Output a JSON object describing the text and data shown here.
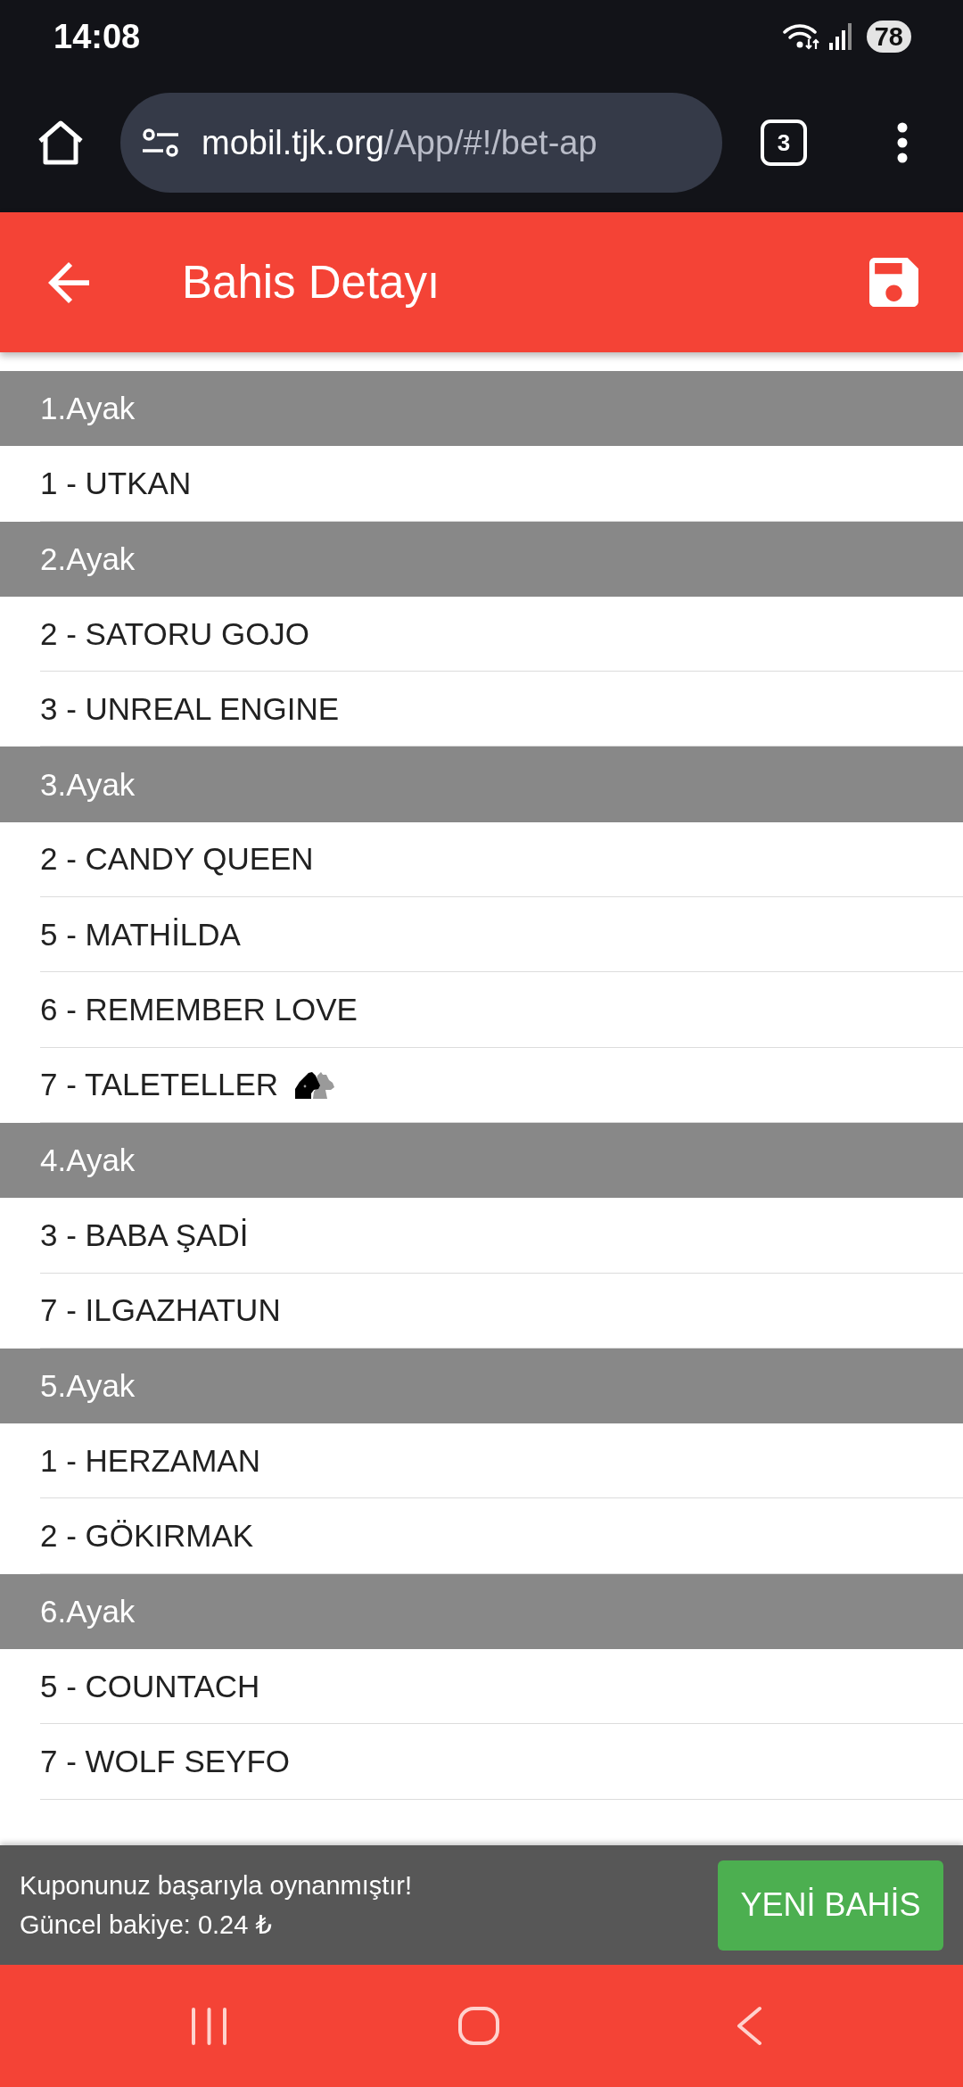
{
  "status_bar": {
    "time": "14:08",
    "battery": "78"
  },
  "browser_toolbar": {
    "url_host": "mobil.tjk.org",
    "url_path": "/App/#!/bet-ap",
    "tab_count": "3"
  },
  "app_bar": {
    "title": "Bahis Detayı"
  },
  "legs": [
    {
      "title": "1.Ayak",
      "runners": [
        {
          "label": "1 - UTKAN",
          "has_icon": false
        }
      ]
    },
    {
      "title": "2.Ayak",
      "runners": [
        {
          "label": "2 - SATORU GOJO",
          "has_icon": false
        },
        {
          "label": "3 - UNREAL ENGINE",
          "has_icon": false
        }
      ]
    },
    {
      "title": "3.Ayak",
      "runners": [
        {
          "label": "2 - CANDY QUEEN",
          "has_icon": false
        },
        {
          "label": "5 - MATHİLDA",
          "has_icon": false
        },
        {
          "label": "6 - REMEMBER LOVE",
          "has_icon": false
        },
        {
          "label": "7 - TALETELLER",
          "has_icon": true
        }
      ]
    },
    {
      "title": "4.Ayak",
      "runners": [
        {
          "label": "3 - BABA ŞADİ",
          "has_icon": false
        },
        {
          "label": "7 - ILGAZHATUN",
          "has_icon": false
        }
      ]
    },
    {
      "title": "5.Ayak",
      "runners": [
        {
          "label": "1 - HERZAMAN",
          "has_icon": false
        },
        {
          "label": "2 - GÖKIRMAK",
          "has_icon": false
        }
      ]
    },
    {
      "title": "6.Ayak",
      "runners": [
        {
          "label": "5 - COUNTACH",
          "has_icon": false
        },
        {
          "label": "7 - WOLF SEYFO",
          "has_icon": false
        }
      ]
    }
  ],
  "snackbar": {
    "message": "Kuponunuz başarıyla oynanmıştır!",
    "balance": "Güncel bakiye: 0.24 ₺",
    "button": "YENİ BAHİS"
  }
}
